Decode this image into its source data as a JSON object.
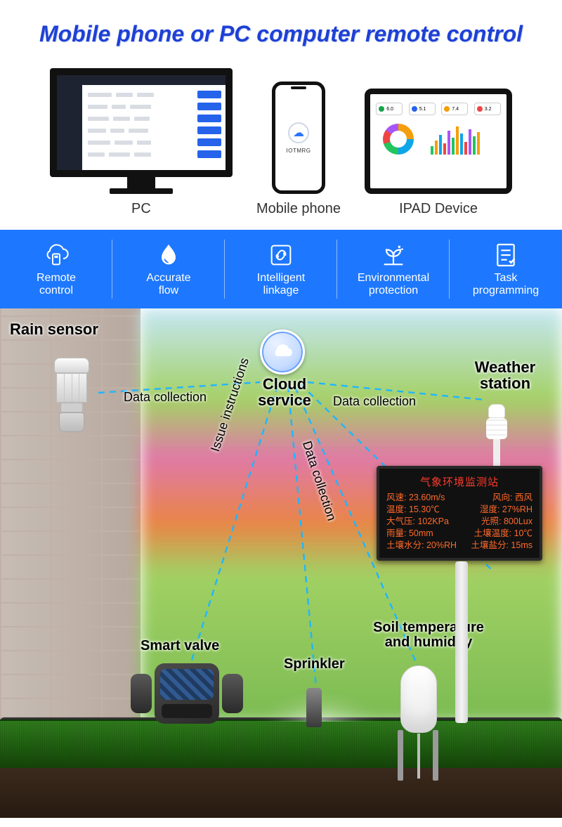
{
  "title": "Mobile phone or PC computer remote control",
  "devices": {
    "pc_label": "PC",
    "phone_label": "Mobile phone",
    "ipad_label": "IPAD Device",
    "phone_brand": "IOTMRG"
  },
  "features": [
    {
      "label": "Remote\ncontrol"
    },
    {
      "label": "Accurate\nflow"
    },
    {
      "label": "Intelligent\nlinkage"
    },
    {
      "label": "Environmental\nprotection"
    },
    {
      "label": "Task\nprogramming"
    }
  ],
  "diagram": {
    "rain_sensor": "Rain sensor",
    "cloud_service": "Cloud\nservice",
    "weather_station": "Weather\nstation",
    "smart_valve": "Smart valve",
    "sprinkler": "Sprinkler",
    "soil": "Soil temperature\nand humidity",
    "links": {
      "data_collection": "Data collection",
      "issue_instructions": "Issue instructions"
    }
  },
  "weather_panel": {
    "title": "气象环境监测站",
    "rows": [
      {
        "l": "风速: 23.60m/s",
        "r": "风向: 西风"
      },
      {
        "l": "温度: 15.30℃",
        "r": "湿度: 27%RH"
      },
      {
        "l": "大气压: 102KPa",
        "r": "光照: 800Lux"
      },
      {
        "l": "雨量: 50mm",
        "r": "土壤温度: 10℃"
      },
      {
        "l": "土壤水分: 20%RH",
        "r": "土壤盐分: 15ms"
      }
    ]
  },
  "chart_data": {
    "tablet_badges": [
      {
        "color": "#16a34a",
        "text": "6.0"
      },
      {
        "color": "#2563eb",
        "text": "5.1"
      },
      {
        "color": "#f59e0b",
        "text": "7.4"
      },
      {
        "color": "#ef4444",
        "text": "3.2"
      }
    ],
    "tablet_bars": {
      "type": "bar",
      "values": [
        12,
        20,
        28,
        16,
        34,
        24,
        40,
        30,
        18,
        36,
        26,
        32
      ],
      "colors": [
        "#22c55e",
        "#f59e0b",
        "#0ea5e9",
        "#ef4444",
        "#a855f7",
        "#22c55e",
        "#f59e0b",
        "#0ea5e9",
        "#ef4444",
        "#a855f7",
        "#22c55e",
        "#f59e0b"
      ]
    }
  }
}
